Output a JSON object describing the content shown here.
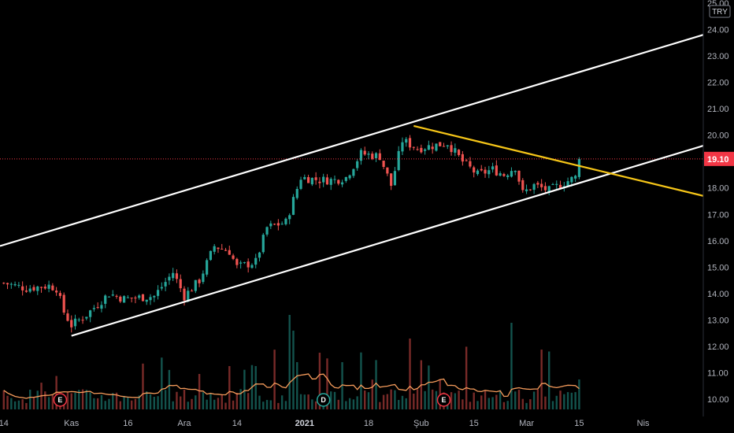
{
  "chart_data": {
    "type": "candlestick",
    "currency": "TRY",
    "last_price": 19.1,
    "y_axis": {
      "min": 9.7,
      "max": 25.0,
      "ticks": [
        10.0,
        11.0,
        12.0,
        13.0,
        14.0,
        15.0,
        16.0,
        17.0,
        18.0,
        19.0,
        20.0,
        21.0,
        22.0,
        23.0,
        24.0,
        25.0
      ]
    },
    "x_axis": {
      "labels": [
        {
          "text": "14",
          "bold": false,
          "day": 0
        },
        {
          "text": "Kas",
          "bold": false,
          "day": 18
        },
        {
          "text": "16",
          "bold": false,
          "day": 33
        },
        {
          "text": "Ara",
          "bold": false,
          "day": 48
        },
        {
          "text": "14",
          "bold": false,
          "day": 62
        },
        {
          "text": "2021",
          "bold": true,
          "day": 80
        },
        {
          "text": "18",
          "bold": false,
          "day": 97
        },
        {
          "text": "Şub",
          "bold": false,
          "day": 111
        },
        {
          "text": "15",
          "bold": false,
          "day": 125
        },
        {
          "text": "Mar",
          "bold": false,
          "day": 139
        },
        {
          "text": "15",
          "bold": false,
          "day": 153
        },
        {
          "text": "Nis",
          "bold": false,
          "day": 170
        }
      ],
      "day_min": -1,
      "day_max": 186
    },
    "price_anchors": [
      {
        "day": 0,
        "price": 14.4
      },
      {
        "day": 6,
        "price": 14.2
      },
      {
        "day": 12,
        "price": 14.3
      },
      {
        "day": 14,
        "price": 14.2
      },
      {
        "day": 16,
        "price": 13.3
      },
      {
        "day": 18,
        "price": 12.8
      },
      {
        "day": 22,
        "price": 13.2
      },
      {
        "day": 28,
        "price": 14.0
      },
      {
        "day": 32,
        "price": 13.8
      },
      {
        "day": 40,
        "price": 13.9
      },
      {
        "day": 45,
        "price": 14.8
      },
      {
        "day": 48,
        "price": 13.9
      },
      {
        "day": 52,
        "price": 14.5
      },
      {
        "day": 56,
        "price": 15.8
      },
      {
        "day": 60,
        "price": 15.6
      },
      {
        "day": 62,
        "price": 15.0
      },
      {
        "day": 67,
        "price": 15.2
      },
      {
        "day": 70,
        "price": 16.5
      },
      {
        "day": 75,
        "price": 16.7
      },
      {
        "day": 79,
        "price": 18.4
      },
      {
        "day": 84,
        "price": 18.3
      },
      {
        "day": 88,
        "price": 18.3
      },
      {
        "day": 91,
        "price": 18.4
      },
      {
        "day": 95,
        "price": 19.3
      },
      {
        "day": 100,
        "price": 19.2
      },
      {
        "day": 103,
        "price": 18.1
      },
      {
        "day": 106,
        "price": 19.8
      },
      {
        "day": 110,
        "price": 19.5
      },
      {
        "day": 114,
        "price": 19.6
      },
      {
        "day": 118,
        "price": 19.7
      },
      {
        "day": 122,
        "price": 19.0
      },
      {
        "day": 126,
        "price": 18.5
      },
      {
        "day": 130,
        "price": 18.7
      },
      {
        "day": 133,
        "price": 18.5
      },
      {
        "day": 136,
        "price": 18.8
      },
      {
        "day": 138,
        "price": 17.8
      },
      {
        "day": 141,
        "price": 18.1
      },
      {
        "day": 145,
        "price": 17.9
      },
      {
        "day": 149,
        "price": 18.2
      },
      {
        "day": 152,
        "price": 18.4
      },
      {
        "day": 153,
        "price": 19.1
      }
    ],
    "lines": [
      {
        "name": "channel-upper",
        "color": "#ffffff",
        "from": {
          "day": -1,
          "price": 15.8
        },
        "to": {
          "day": 186,
          "price": 23.8
        }
      },
      {
        "name": "channel-lower",
        "color": "#ffffff",
        "from": {
          "day": 18,
          "price": 12.4
        },
        "to": {
          "day": 186,
          "price": 19.6
        }
      },
      {
        "name": "descending-trendline",
        "color": "#f5c518",
        "from": {
          "day": 109,
          "price": 20.35
        },
        "to": {
          "day": 186,
          "price": 17.7
        }
      }
    ],
    "events": [
      {
        "label": "E",
        "day": 15,
        "color": "#f23645"
      },
      {
        "label": "D",
        "day": 85,
        "color": "#26a69a"
      },
      {
        "label": "E",
        "day": 117,
        "color": "#f23645"
      }
    ],
    "colors": {
      "up": "#26a69a",
      "down": "#ef5350",
      "volume_ma": "#f59b5b",
      "price_line": "#f23645",
      "grid": "#131722"
    }
  }
}
